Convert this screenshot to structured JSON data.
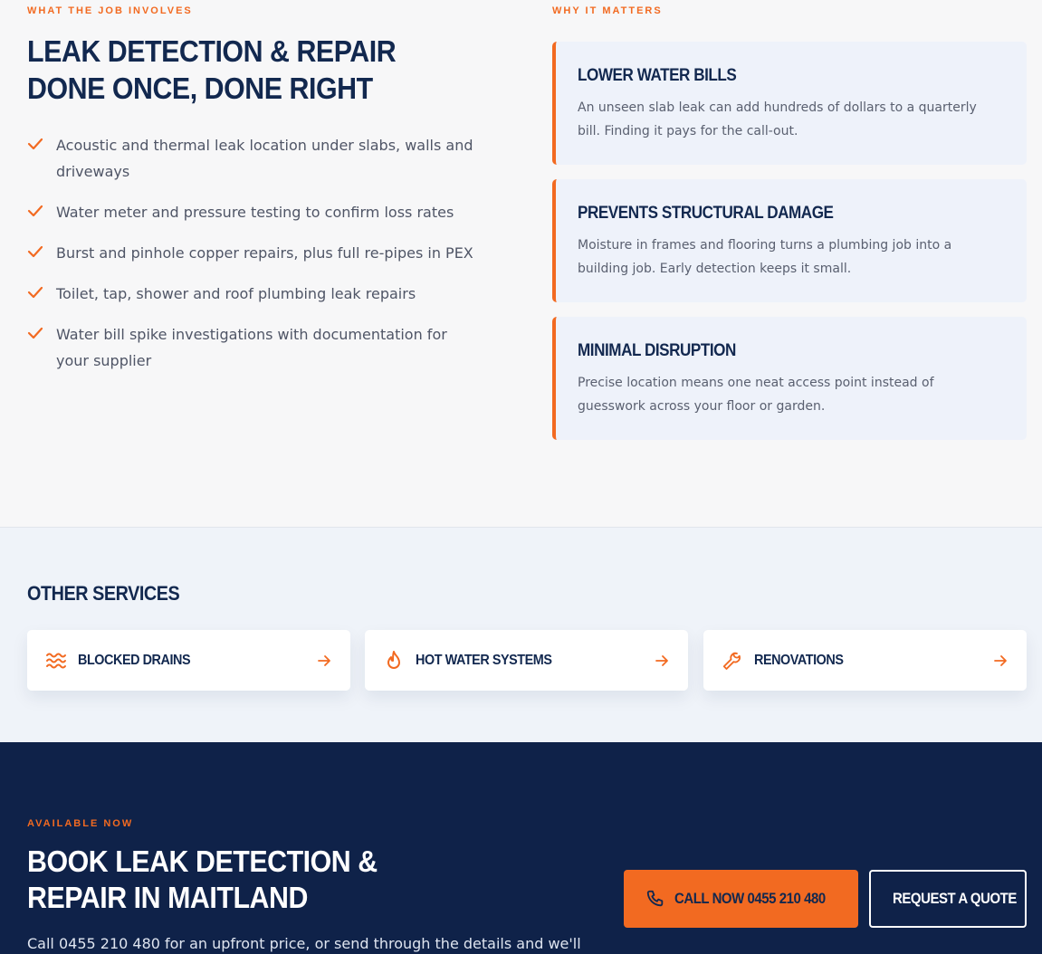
{
  "job": {
    "eyebrow": "WHAT THE JOB INVOLVES",
    "title": "LEAK DETECTION & REPAIR DONE ONCE, DONE RIGHT",
    "items": [
      "Acoustic and thermal leak location under slabs, walls and driveways",
      "Water meter and pressure testing to confirm loss rates",
      "Burst and pinhole copper repairs, plus full re-pipes in PEX",
      "Toilet, tap, shower and roof plumbing leak repairs",
      "Water bill spike investigations with documentation for your supplier"
    ]
  },
  "why": {
    "eyebrow": "WHY IT MATTERS",
    "cards": [
      {
        "title": "LOWER WATER BILLS",
        "text": "An unseen slab leak can add hundreds of dollars to a quarterly bill. Finding it pays for the call-out."
      },
      {
        "title": "PREVENTS STRUCTURAL DAMAGE",
        "text": "Moisture in frames and flooring turns a plumbing job into a building job. Early detection keeps it small."
      },
      {
        "title": "MINIMAL DISRUPTION",
        "text": "Precise location means one neat access point instead of guesswork across your floor or garden."
      }
    ]
  },
  "other": {
    "title": "OTHER SERVICES",
    "services": [
      {
        "label": "BLOCKED DRAINS",
        "icon": "waves-icon"
      },
      {
        "label": "HOT WATER SYSTEMS",
        "icon": "flame-icon"
      },
      {
        "label": "RENOVATIONS",
        "icon": "wrench-icon"
      }
    ]
  },
  "cta": {
    "eyebrow": "AVAILABLE NOW",
    "title": "BOOK LEAK DETECTION & REPAIR IN MAITLAND",
    "text": "Call 0455 210 480 for an upfront price, or send through the details and we'll",
    "call_label": "CALL NOW  0455 210 480",
    "quote_label": "REQUEST A QUOTE"
  },
  "colors": {
    "accent": "#f26a21",
    "navy": "#12284f",
    "dark": "#0f2249"
  }
}
